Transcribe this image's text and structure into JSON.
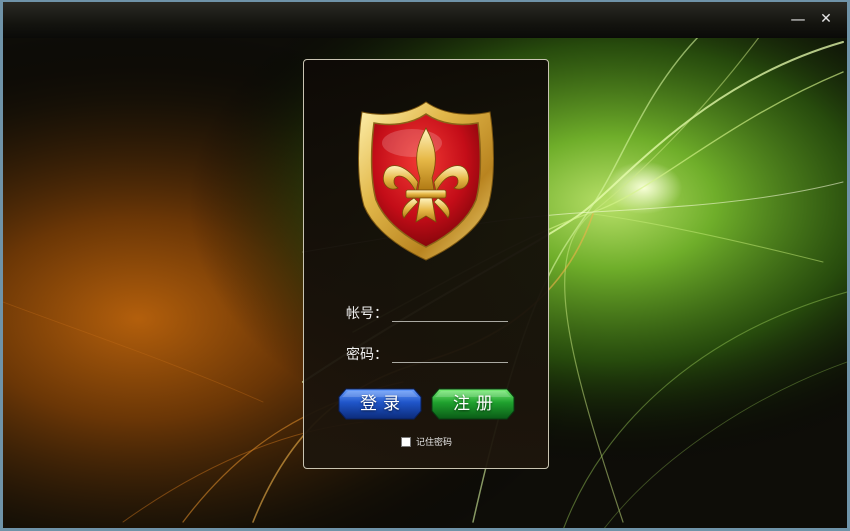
{
  "window": {
    "minimize_glyph": "—",
    "close_glyph": "✕"
  },
  "login": {
    "logo_icon": "fleur-de-lis-shield-icon",
    "account_label": "帐号：",
    "account_value": "",
    "password_label": "密码：",
    "password_value": "",
    "login_button": "登录",
    "register_button": "注册",
    "remember_label": "记住密码",
    "remember_checked": false
  },
  "colors": {
    "login_button": "#1e56c8",
    "register_button": "#1fa12e",
    "shield_red": "#c8101c",
    "shield_gold": "#e9c45a"
  }
}
